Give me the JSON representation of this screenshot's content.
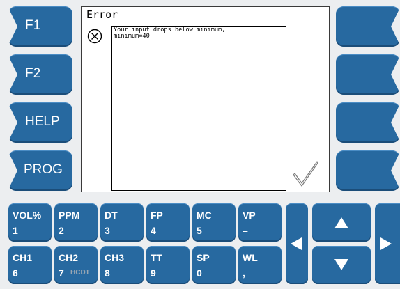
{
  "function_keys": {
    "left": [
      {
        "id": "f1",
        "label": "F1"
      },
      {
        "id": "f2",
        "label": "F2"
      },
      {
        "id": "help",
        "label": "HELP"
      },
      {
        "id": "prog",
        "label": "PROG"
      }
    ],
    "right": [
      {
        "id": "r1",
        "label": ""
      },
      {
        "id": "r2",
        "label": ""
      },
      {
        "id": "r3",
        "label": ""
      },
      {
        "id": "r4",
        "label": ""
      }
    ]
  },
  "dialog": {
    "title": "Error",
    "icon": "error-x-circle-icon",
    "message_line1": "Your input drops below minimum,",
    "message_line2": "minimum=40",
    "confirm_icon": "checkmark-icon"
  },
  "keypad": {
    "row1": [
      {
        "id": "vol",
        "top": "VOL%",
        "bottom": "1"
      },
      {
        "id": "ppm",
        "top": "PPM",
        "bottom": "2"
      },
      {
        "id": "dt",
        "top": "DT",
        "bottom": "3"
      },
      {
        "id": "fp",
        "top": "FP",
        "bottom": "4"
      },
      {
        "id": "mc",
        "top": "MC",
        "bottom": "5"
      },
      {
        "id": "vp",
        "top": "VP",
        "bottom": "–"
      }
    ],
    "row2": [
      {
        "id": "ch1",
        "top": "CH1",
        "bottom": "6",
        "sub": ""
      },
      {
        "id": "ch2",
        "top": "CH2",
        "bottom": "7",
        "sub": "HCDT"
      },
      {
        "id": "ch3",
        "top": "CH3",
        "bottom": "8",
        "sub": ""
      },
      {
        "id": "tt",
        "top": "TT",
        "bottom": "9",
        "sub": ""
      },
      {
        "id": "sp",
        "top": "SP",
        "bottom": "0",
        "sub": ""
      },
      {
        "id": "wl",
        "top": "WL",
        "bottom": ",",
        "sub": ""
      }
    ]
  },
  "arrows": {
    "left": "arrow-left-icon",
    "up": "arrow-up-icon",
    "down": "arrow-down-icon",
    "right": "arrow-right-icon"
  },
  "colors": {
    "key_blue": "#2769a0",
    "background": "#eceef0"
  }
}
